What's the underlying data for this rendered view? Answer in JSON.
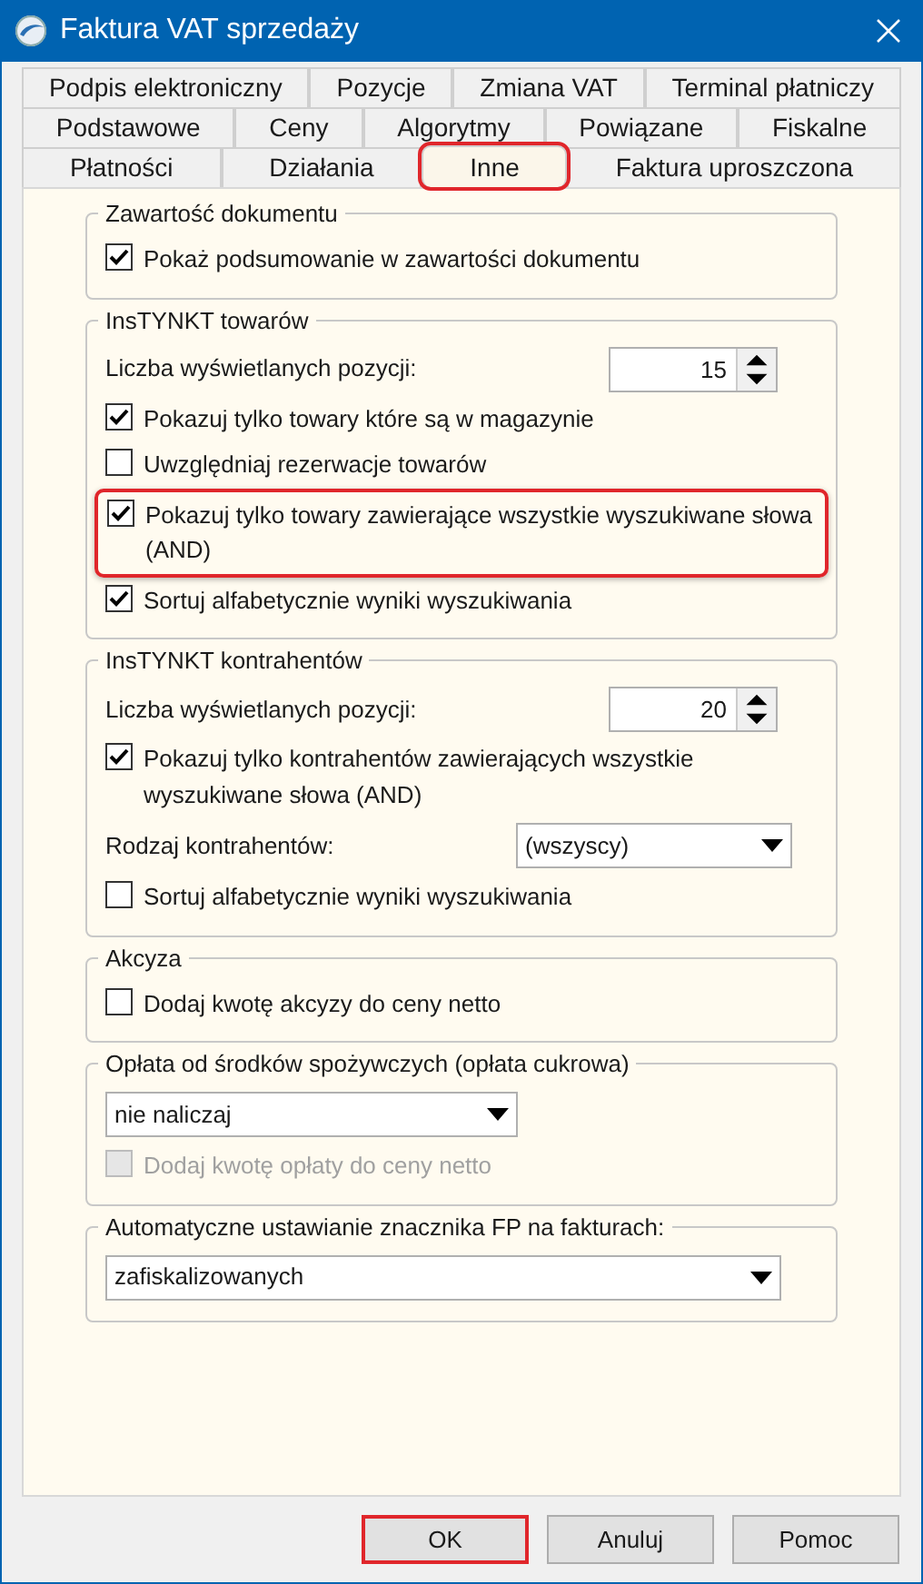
{
  "window": {
    "title": "Faktura VAT sprzedaży"
  },
  "tab_rows": [
    [
      {
        "label": "Podpis elektroniczny",
        "selected": false,
        "highlighted": false
      },
      {
        "label": "Pozycje",
        "selected": false,
        "highlighted": false
      },
      {
        "label": "Zmiana VAT",
        "selected": false,
        "highlighted": false
      },
      {
        "label": "Terminal płatniczy",
        "selected": false,
        "highlighted": false
      }
    ],
    [
      {
        "label": "Podstawowe",
        "selected": false,
        "highlighted": false
      },
      {
        "label": "Ceny",
        "selected": false,
        "highlighted": false
      },
      {
        "label": "Algorytmy",
        "selected": false,
        "highlighted": false
      },
      {
        "label": "Powiązane",
        "selected": false,
        "highlighted": false
      },
      {
        "label": "Fiskalne",
        "selected": false,
        "highlighted": false
      }
    ],
    [
      {
        "label": "Płatności",
        "selected": false,
        "highlighted": false
      },
      {
        "label": "Działania",
        "selected": false,
        "highlighted": false
      },
      {
        "label": "Inne",
        "selected": true,
        "highlighted": true
      },
      {
        "label": "Faktura uproszczona",
        "selected": false,
        "highlighted": false
      }
    ]
  ],
  "groups": [
    {
      "title": "Zawartość dokumentu",
      "items": [
        {
          "kind": "checkbox",
          "label": "Pokaż podsumowanie w zawartości dokumentu",
          "checked": true,
          "disabled": false,
          "highlighted": false
        }
      ]
    },
    {
      "title": "InsTYNKT towarów",
      "items": [
        {
          "kind": "spinner",
          "label": "Liczba wyświetlanych pozycji:",
          "value": "15"
        },
        {
          "kind": "checkbox",
          "label": "Pokazuj tylko towary które są w magazynie",
          "checked": true,
          "disabled": false,
          "highlighted": false
        },
        {
          "kind": "checkbox",
          "label": "Uwzględniaj rezerwacje towarów",
          "checked": false,
          "disabled": false,
          "highlighted": false
        },
        {
          "kind": "checkbox",
          "label": "Pokazuj tylko towary zawierające wszystkie wyszukiwane słowa (AND)",
          "checked": true,
          "disabled": false,
          "highlighted": true
        },
        {
          "kind": "checkbox",
          "label": "Sortuj alfabetycznie wyniki wyszukiwania",
          "checked": true,
          "disabled": false,
          "highlighted": false
        }
      ]
    },
    {
      "title": "InsTYNKT kontrahentów",
      "items": [
        {
          "kind": "spinner",
          "label": "Liczba wyświetlanych pozycji:",
          "value": "20"
        },
        {
          "kind": "checkbox",
          "label": "Pokazuj tylko kontrahentów zawierających wszystkie wyszukiwane słowa (AND)",
          "checked": true,
          "disabled": false,
          "highlighted": false
        },
        {
          "kind": "labeled_select",
          "label": "Rodzaj kontrahentów:",
          "value": "(wszyscy)"
        },
        {
          "kind": "checkbox",
          "label": "Sortuj alfabetycznie wyniki wyszukiwania",
          "checked": false,
          "disabled": false,
          "highlighted": false
        }
      ]
    },
    {
      "title": "Akcyza",
      "items": [
        {
          "kind": "checkbox",
          "label": "Dodaj kwotę akcyzy do ceny netto",
          "checked": false,
          "disabled": false,
          "highlighted": false
        }
      ]
    },
    {
      "title": "Opłata od środków spożywczych (opłata cukrowa)",
      "items": [
        {
          "kind": "select",
          "value": "nie naliczaj",
          "wide": false
        },
        {
          "kind": "checkbox",
          "label": "Dodaj kwotę opłaty do ceny netto",
          "checked": false,
          "disabled": true,
          "highlighted": false
        }
      ]
    },
    {
      "title": "Automatyczne ustawianie znacznika FP na fakturach:",
      "items": [
        {
          "kind": "select",
          "value": "zafiskalizowanych",
          "wide": true
        }
      ]
    }
  ],
  "buttons": [
    {
      "label": "OK",
      "highlighted": true
    },
    {
      "label": "Anuluj",
      "highlighted": false
    },
    {
      "label": "Pomoc",
      "highlighted": false
    }
  ]
}
